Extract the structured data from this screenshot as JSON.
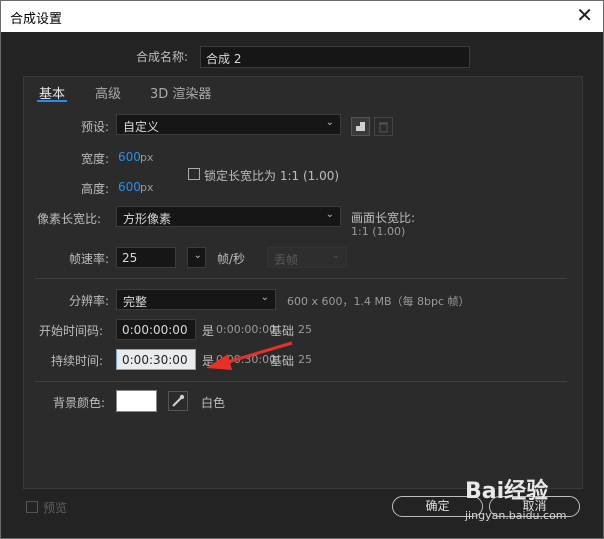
{
  "window": {
    "title": "合成设置",
    "close_glyph": "✕"
  },
  "comp_name": {
    "label": "合成名称:",
    "value": "合成 2"
  },
  "tabs": [
    {
      "label": "基本"
    },
    {
      "label": "高级"
    },
    {
      "label": "3D 渲染器"
    }
  ],
  "preset": {
    "label": "预设:",
    "value": "自定义"
  },
  "width": {
    "label": "宽度:",
    "value": "600",
    "unit": "px"
  },
  "height": {
    "label": "高度:",
    "value": "600",
    "unit": "px"
  },
  "lock_ratio": {
    "label": "锁定长宽比为 1:1 (1.00)",
    "checked": false
  },
  "pixel_aspect": {
    "label": "像素长宽比:",
    "value": "方形像素"
  },
  "frame_aspect": {
    "label": "画面长宽比:",
    "value": "1:1 (1.00)"
  },
  "frame_rate": {
    "label": "帧速率:",
    "value": "25",
    "unit": "帧/秒",
    "drop_frame": "丢帧"
  },
  "resolution": {
    "label": "分辨率:",
    "value": "完整",
    "info": "600 x 600，1.4 MB（每 8bpc 帧）"
  },
  "start_timecode": {
    "label": "开始时间码:",
    "value": "0:00:00:00",
    "is_label": "是",
    "is_value": "0:00:00:00",
    "base_label": "基础",
    "base_value": "25"
  },
  "duration": {
    "label": "持续时间:",
    "value": "0:00:30:00",
    "is_label": "是",
    "is_value": "0:00:30:00",
    "base_label": "基础",
    "base_value": "25"
  },
  "bg_color": {
    "label": "背景颜色:",
    "name": "白色",
    "swatch": "#ffffff"
  },
  "preview": {
    "label": "预览",
    "checked": false
  },
  "ok_button": {
    "label": "确定"
  },
  "cancel_button": {
    "label": "取消"
  },
  "watermark": {
    "brand": "Bai经验",
    "url": "jingyan.baidu.com"
  },
  "colors": {
    "accent": "#2d8ceb",
    "arrow": "#e8302a",
    "bg": "#232323"
  }
}
